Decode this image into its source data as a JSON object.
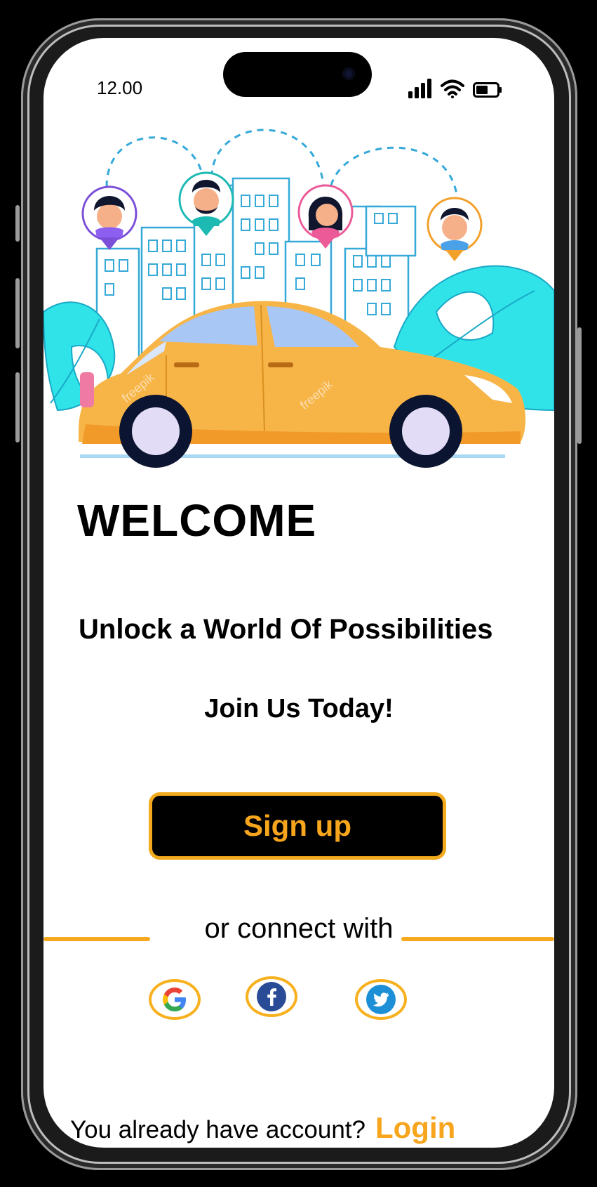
{
  "status_bar": {
    "time": "12.00",
    "signal_icon": "cellular-signal-icon",
    "wifi_icon": "wifi-icon",
    "battery_icon": "battery-icon"
  },
  "hero": {
    "illustration": "taxi-car-with-passenger-location-pins",
    "watermark": "freepik"
  },
  "welcome": {
    "title": "WELCOME",
    "tagline": "Unlock a World Of Possibilities",
    "cta_text": "Join Us Today!"
  },
  "actions": {
    "signup_label": "Sign up",
    "connect_label": "or connect with"
  },
  "social": [
    {
      "name": "google",
      "icon": "google-icon"
    },
    {
      "name": "facebook",
      "icon": "facebook-icon"
    },
    {
      "name": "twitter",
      "icon": "twitter-icon"
    }
  ],
  "footer": {
    "question": "You already have account?",
    "login_label": "Login"
  },
  "colors": {
    "accent": "#f6a51c",
    "car": "#f7b447",
    "leaves": "#2fe3e8",
    "buildings": "#35a9d8",
    "button_bg": "#000000"
  }
}
